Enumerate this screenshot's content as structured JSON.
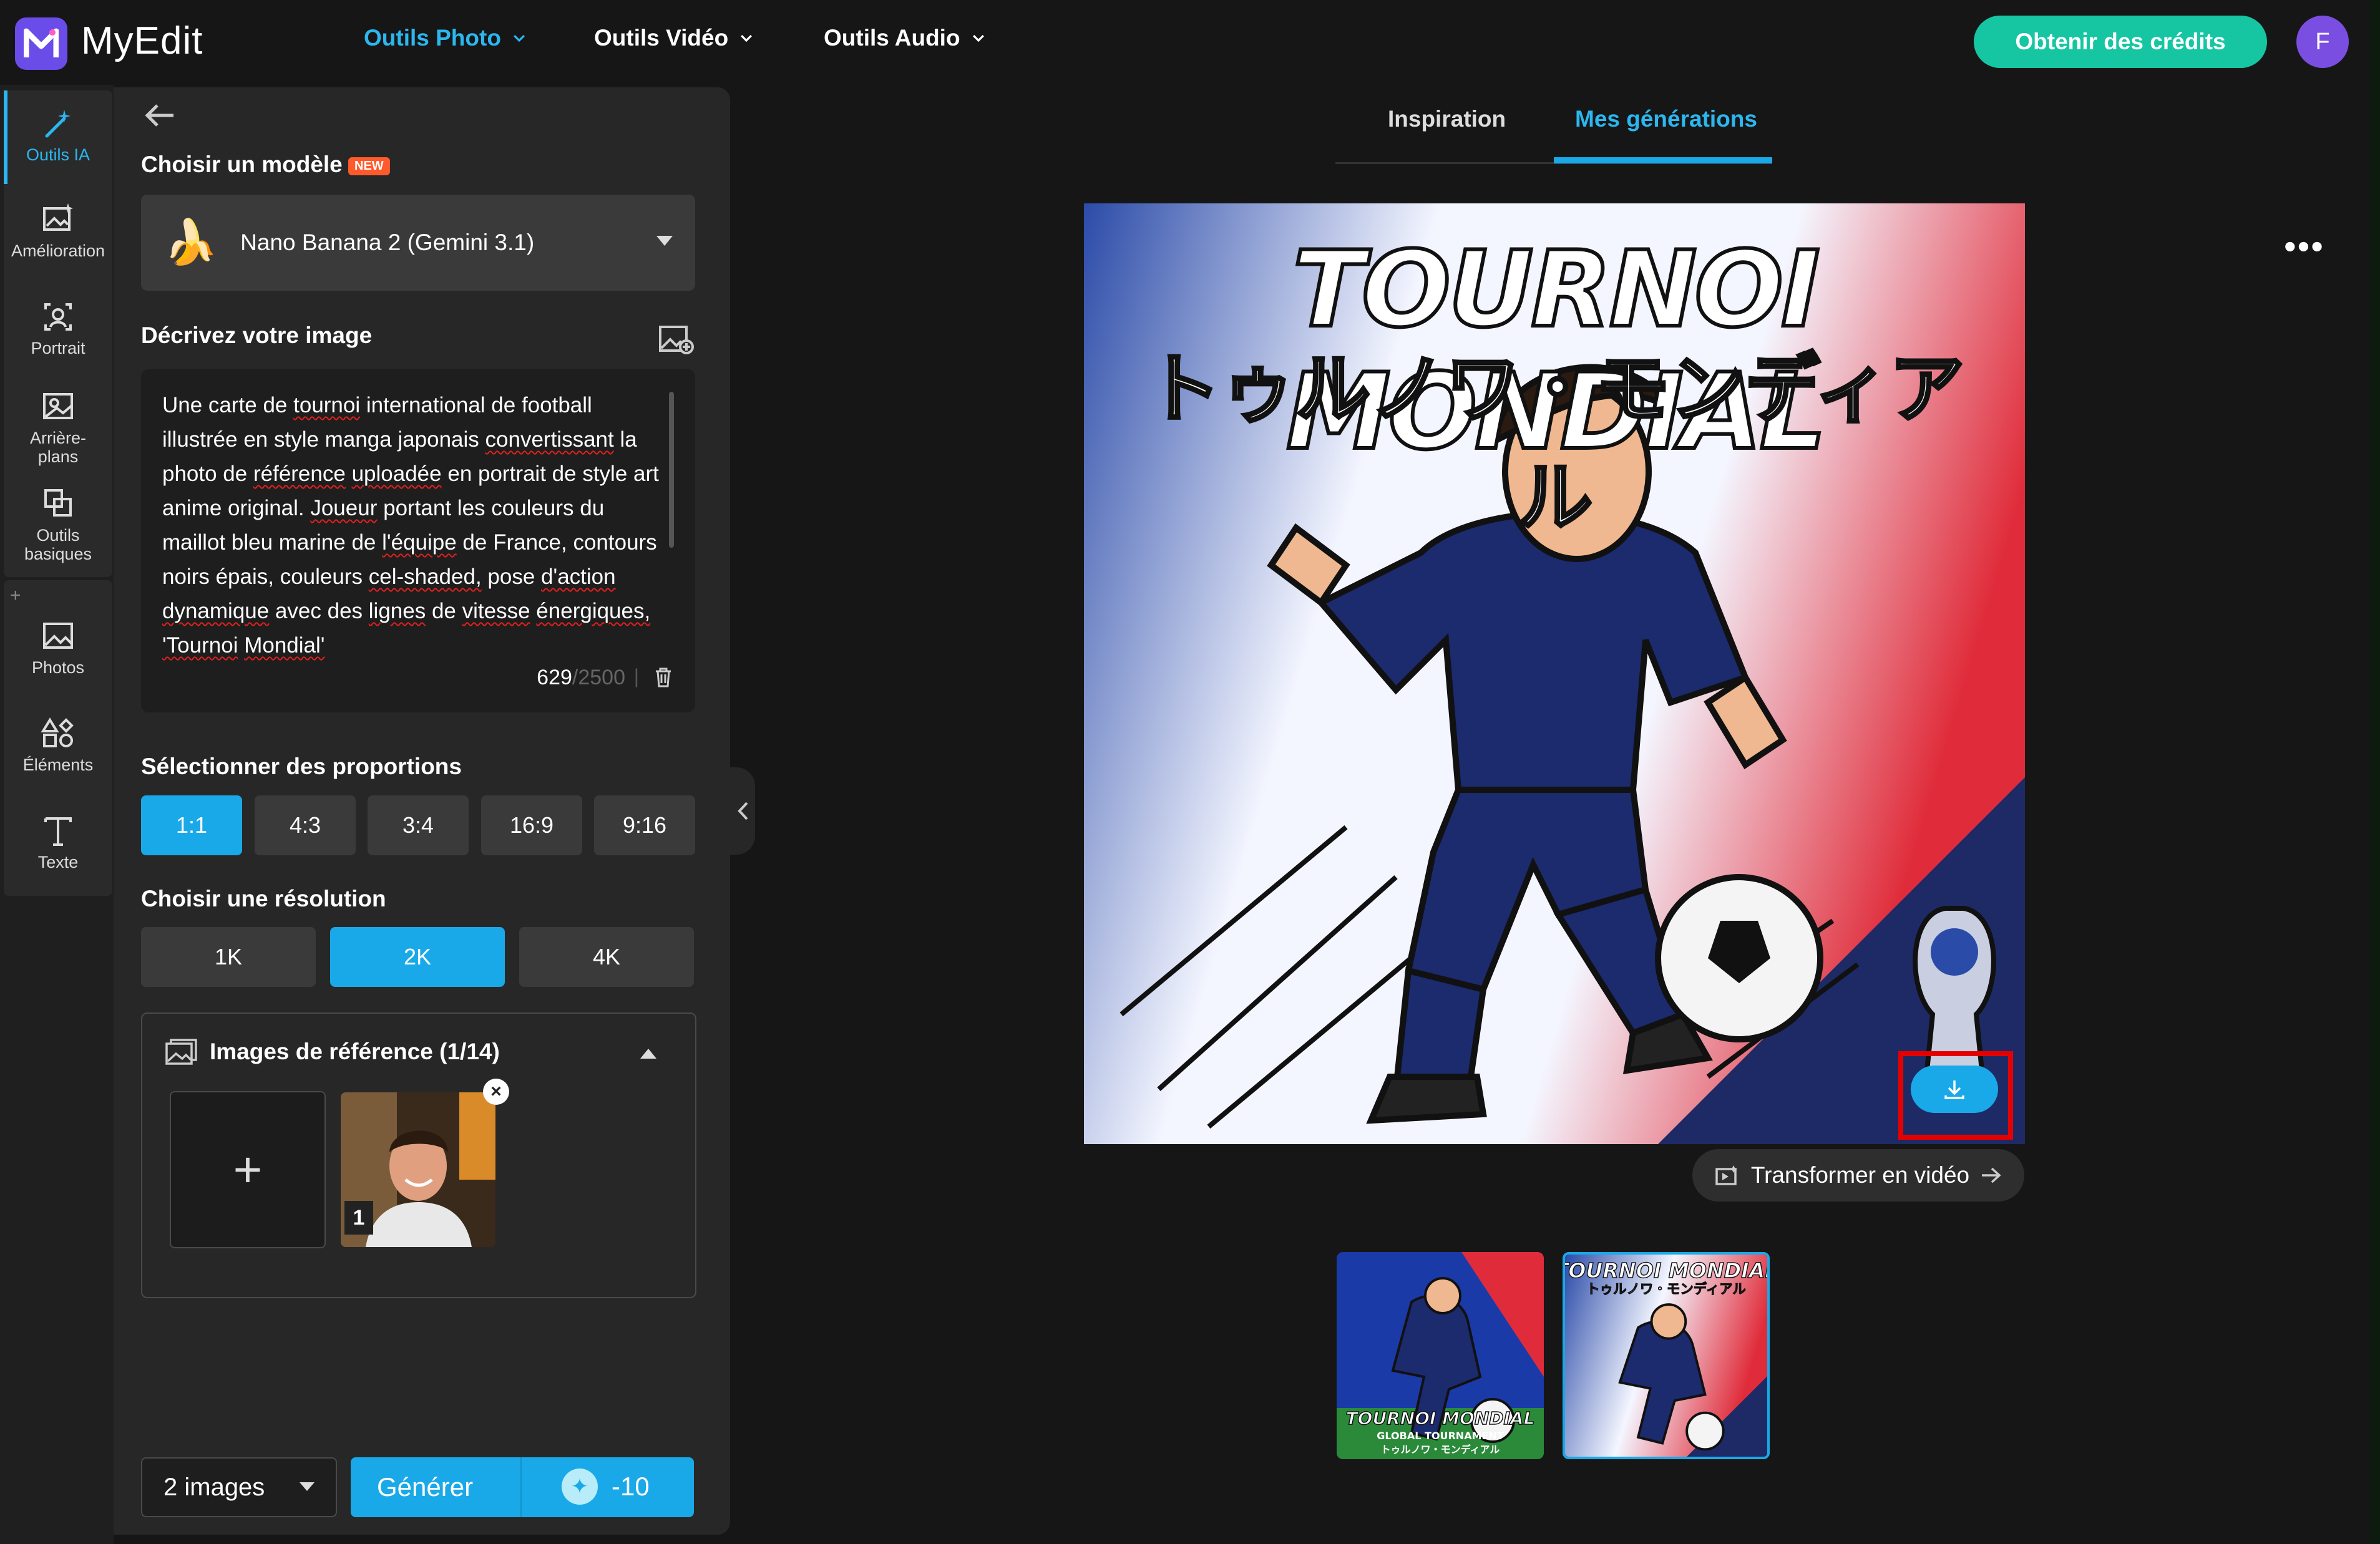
{
  "app": {
    "name": "MyEdit"
  },
  "nav": {
    "items": [
      {
        "label": "Outils Photo",
        "active": true
      },
      {
        "label": "Outils Vidéo",
        "active": false
      },
      {
        "label": "Outils Audio",
        "active": false
      }
    ],
    "credits_button": "Obtenir des crédits",
    "avatar_initial": "F"
  },
  "rail": {
    "items": [
      {
        "label": "Outils IA",
        "icon": "magic-wand-icon",
        "active": true
      },
      {
        "label": "Amélioration",
        "icon": "image-enhance-icon"
      },
      {
        "label": "Portrait",
        "icon": "portrait-icon"
      },
      {
        "label": "Arrière-plans",
        "icon": "background-icon"
      },
      {
        "label": "Outils basiques",
        "icon": "crop-icon"
      },
      {
        "label": "Photos",
        "icon": "photo-icon"
      },
      {
        "label": "Éléments",
        "icon": "shapes-icon"
      },
      {
        "label": "Texte",
        "icon": "text-icon"
      }
    ],
    "plus": "+"
  },
  "panel": {
    "model_label": "Choisir un modèle",
    "new_badge": "NEW",
    "model_emoji": "🍌",
    "model_name": "Nano Banana 2 (Gemini 3.1)",
    "describe_label": "Décrivez votre image",
    "prompt_text": "Une carte de tournoi international de football illustrée en style manga japonais convertissant la photo de référence uploadée en portrait de style art anime original. Joueur portant les couleurs du maillot bleu marine de l'équipe de France, contours noirs épais, couleurs cel-shaded, pose d'action dynamique avec des lignes de vitesse énergiques, 'Tournoi Mondial'",
    "prompt_count": "629",
    "prompt_max": "/2500",
    "prompt_sep": "|",
    "ratio_label": "Sélectionner des proportions",
    "ratios": [
      "1:1",
      "4:3",
      "3:4",
      "16:9",
      "9:16"
    ],
    "ratio_selected": "1:1",
    "resolution_label": "Choisir une résolution",
    "resolutions": [
      "1K",
      "2K",
      "4K"
    ],
    "resolution_selected": "2K",
    "reference_label": "Images de référence (1/14)",
    "reference_add": "+",
    "reference_index": "1",
    "reference_close": "×",
    "count_select": "2 images",
    "generate_label": "Générer",
    "generate_cost": "-10"
  },
  "main": {
    "tabs": [
      {
        "label": "Inspiration",
        "active": false
      },
      {
        "label": "Mes générations",
        "active": true
      }
    ],
    "more": "•••",
    "image_title": "TOURNOI MONDIAL",
    "image_subtitle": "トゥルノワ・モンディアル",
    "video_button": "Transformer en vidéo",
    "thumbnails": [
      {
        "title": "TOURNOI MONDIAL",
        "subtitle": "GLOBAL TOURNAMENT",
        "jp": "トゥルノワ・モンディアル"
      },
      {
        "title": "TOURNOI MONDIAL",
        "jp": "トゥルノワ・モンディアル"
      }
    ]
  },
  "colors": {
    "accent": "#19a9e8",
    "credits": "#16c6a2",
    "brand": "#6a4de8",
    "highlight": "#e50000"
  }
}
